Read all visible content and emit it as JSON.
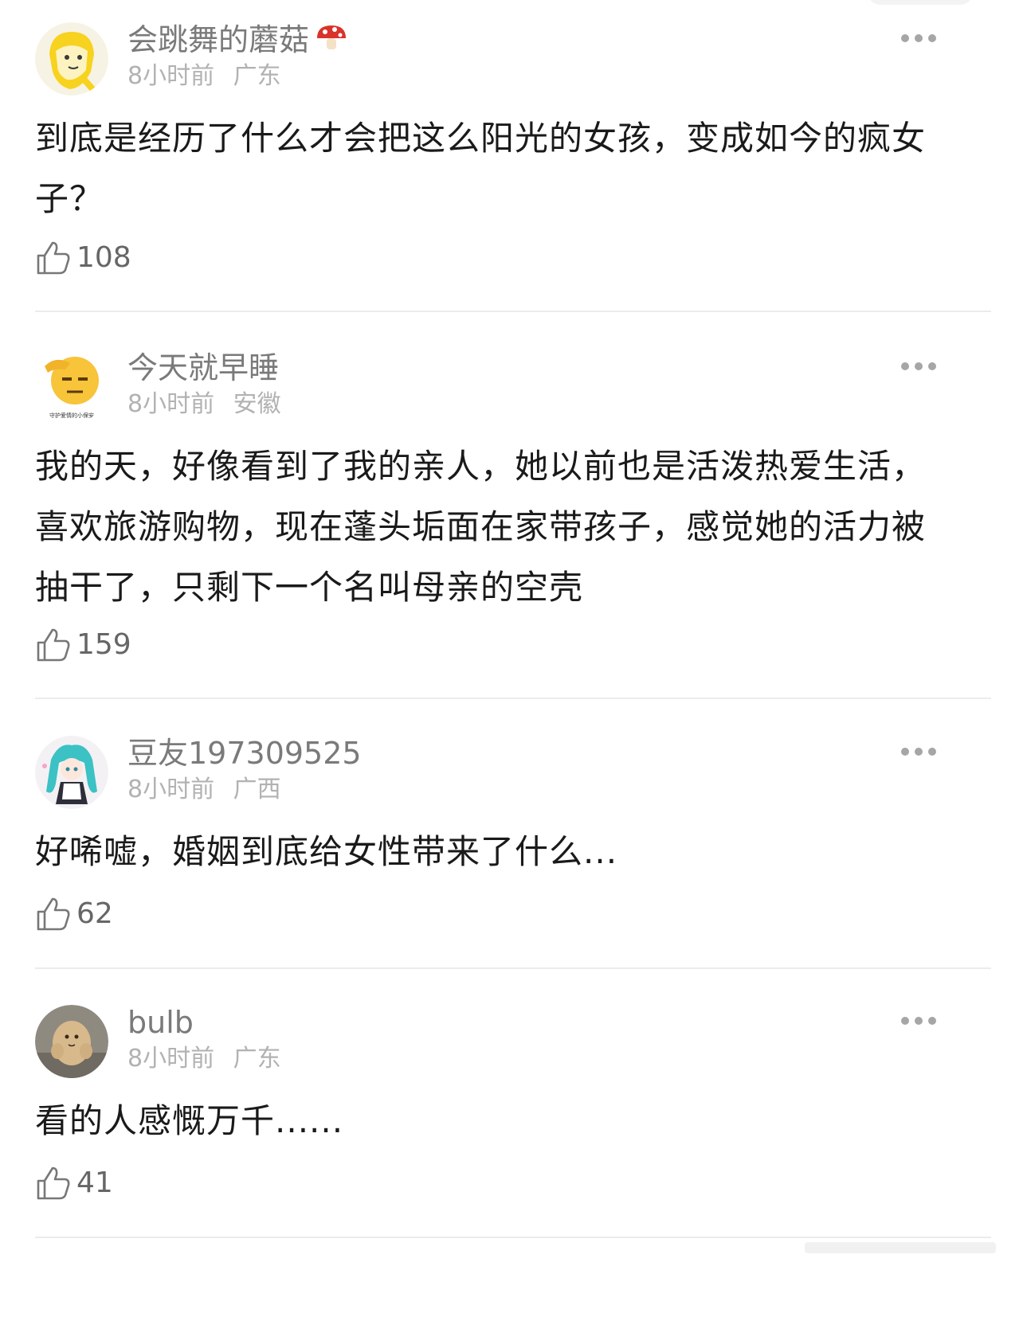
{
  "comments": [
    {
      "username": "会跳舞的蘑菇",
      "badge_icon": "mushroom-icon",
      "time": "8小时前",
      "location": "广东",
      "text": "到底是经历了什么才会把这么阳光的女孩，变成如今的疯女子？",
      "likes": "108"
    },
    {
      "username": "今天就早睡",
      "time": "8小时前",
      "location": "安徽",
      "avatar_caption": "守护爱情的小保安",
      "text": "我的天，好像看到了我的亲人，她以前也是活泼热爱生活，喜欢旅游购物，现在蓬头垢面在家带孩子，感觉她的活力被抽干了，只剩下一个名叫母亲的空壳",
      "likes": "159"
    },
    {
      "username": "豆友197309525",
      "time": "8小时前",
      "location": "广西",
      "text": "好唏嘘，婚姻到底给女性带来了什么...",
      "likes": "62"
    },
    {
      "username": "bulb",
      "time": "8小时前",
      "location": "广东",
      "text": "看的人感慨万千......",
      "likes": "41"
    }
  ],
  "colors": {
    "username": "#7a7a7a",
    "meta": "#b2b2b2",
    "text": "#1a1a1a",
    "divider": "#ececec"
  }
}
